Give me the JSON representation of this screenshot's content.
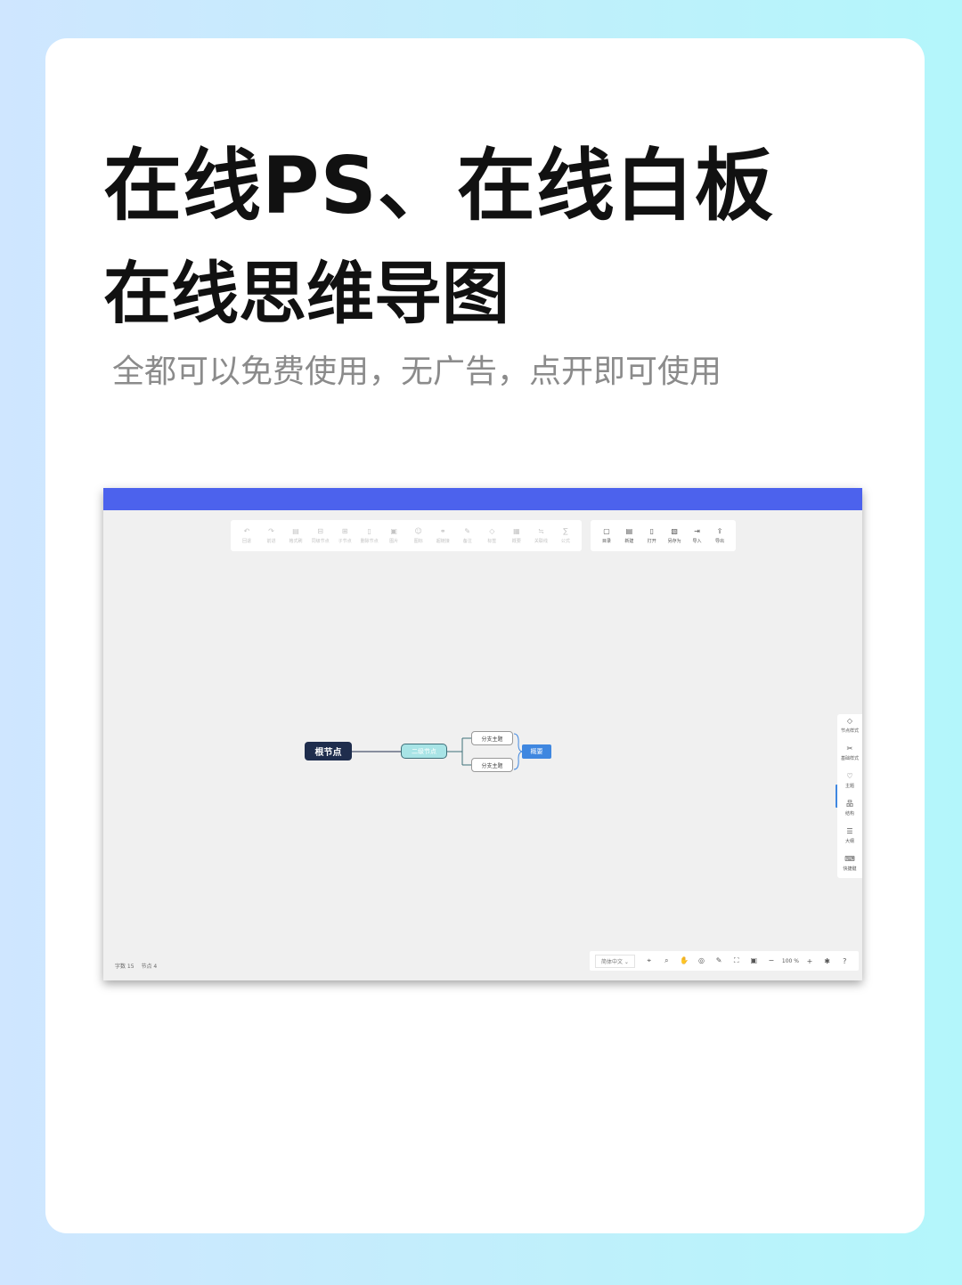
{
  "heading": {
    "line1": "在线PS、在线白板",
    "line2": "在线思维导图",
    "subtitle": "全都可以免费使用，无广告，点开即可使用"
  },
  "app": {
    "edit_toolbar": [
      {
        "icon": "undo-icon",
        "glyph": "↶",
        "label": "回退"
      },
      {
        "icon": "redo-icon",
        "glyph": "↷",
        "label": "前进"
      },
      {
        "icon": "format-painter-icon",
        "glyph": "▤",
        "label": "格式刷"
      },
      {
        "icon": "insert-sibling-icon",
        "glyph": "⊟",
        "label": "同级节点"
      },
      {
        "icon": "insert-child-icon",
        "glyph": "⊞",
        "label": "子节点"
      },
      {
        "icon": "delete-node-icon",
        "glyph": "▯",
        "label": "删除节点"
      },
      {
        "icon": "image-icon",
        "glyph": "▣",
        "label": "图片"
      },
      {
        "icon": "emoji-icon",
        "glyph": "☺",
        "label": "图标"
      },
      {
        "icon": "link-icon",
        "glyph": "⚭",
        "label": "超链接"
      },
      {
        "icon": "note-icon",
        "glyph": "✎",
        "label": "备注"
      },
      {
        "icon": "tag-icon",
        "glyph": "◇",
        "label": "标签"
      },
      {
        "icon": "summary-icon",
        "glyph": "▦",
        "label": "概要"
      },
      {
        "icon": "associative-line-icon",
        "glyph": "≒",
        "label": "关联线"
      },
      {
        "icon": "formula-icon",
        "glyph": "∑",
        "label": "公式"
      }
    ],
    "file_toolbar": [
      {
        "icon": "directory-icon",
        "glyph": "▢",
        "label": "目录"
      },
      {
        "icon": "new-file-icon",
        "glyph": "▤",
        "label": "新建"
      },
      {
        "icon": "open-file-icon",
        "glyph": "▯",
        "label": "打开"
      },
      {
        "icon": "save-as-icon",
        "glyph": "▧",
        "label": "另存为"
      },
      {
        "icon": "import-icon",
        "glyph": "⇥",
        "label": "导入"
      },
      {
        "icon": "export-icon",
        "glyph": "⇪",
        "label": "导出"
      }
    ],
    "mindmap": {
      "root": "根节点",
      "second": "二级节点",
      "branches": [
        "分支主题",
        "分支主题"
      ],
      "summary": "概要"
    },
    "right_sidebar": [
      {
        "icon": "node-style-icon",
        "glyph": "◇",
        "label": "节点样式"
      },
      {
        "icon": "base-style-icon",
        "glyph": "✂",
        "label": "基础样式"
      },
      {
        "icon": "theme-icon",
        "glyph": "♡",
        "label": "主题"
      },
      {
        "icon": "structure-icon",
        "glyph": "品",
        "label": "结构"
      },
      {
        "icon": "outline-icon",
        "glyph": "☰",
        "label": "大纲"
      },
      {
        "icon": "shortcut-icon",
        "glyph": "⌨",
        "label": "快捷键"
      }
    ],
    "status": {
      "words": "字数 15",
      "nodes": "节点 4"
    },
    "bottom_bar": {
      "language": "简体中文 ⌄",
      "icons_left": [
        {
          "icon": "navigator-icon",
          "glyph": "⌖"
        },
        {
          "icon": "search-icon",
          "glyph": "⌕"
        },
        {
          "icon": "hand-icon",
          "glyph": "✋"
        },
        {
          "icon": "locate-icon",
          "glyph": "◎"
        },
        {
          "icon": "edit-icon",
          "glyph": "✎"
        },
        {
          "icon": "fit-screen-icon",
          "glyph": "⛶"
        },
        {
          "icon": "fullscreen-icon",
          "glyph": "▣"
        },
        {
          "icon": "zoom-out-icon",
          "glyph": "−"
        }
      ],
      "zoom": "100 %",
      "icons_right": [
        {
          "icon": "zoom-in-icon",
          "glyph": "+"
        },
        {
          "icon": "theme-toggle-icon",
          "glyph": "✱"
        },
        {
          "icon": "help-icon",
          "glyph": "?"
        }
      ]
    },
    "colors": {
      "accent": "#4c62ed",
      "root": "#1f2d4d",
      "second": "#a8e4e6",
      "summary": "#3f87e0"
    }
  }
}
